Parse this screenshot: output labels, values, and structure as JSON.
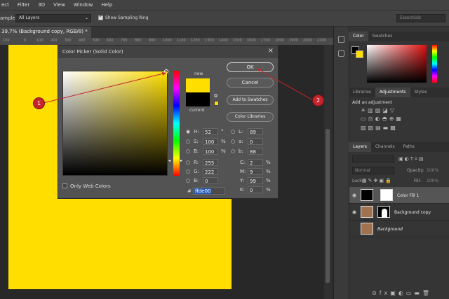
{
  "menubar": {
    "items": [
      "ect",
      "Filter",
      "3D",
      "View",
      "Window",
      "Help"
    ]
  },
  "options": {
    "sample_label": "ample:",
    "sample_value": "All Layers",
    "sampling_ring_label": "Show Sampling Ring",
    "workspace": "Essentials"
  },
  "doc": {
    "tab_title": "39,7% (Background copy, RGB/8) *",
    "ruler_ticks": [
      "100",
      "0",
      "100",
      "200",
      "300",
      "400",
      "500",
      "600",
      "700",
      "800",
      "900",
      "1000",
      "1100",
      "1200",
      "1300",
      "1400",
      "1500",
      "1600",
      "1700",
      "1800",
      "1900",
      "2000",
      "2100"
    ]
  },
  "colors": {
    "fill": "#ffde00",
    "callout": "#c6252c"
  },
  "dialog": {
    "title": "Color Picker (Solid Color)",
    "new_label": "new",
    "current_label": "current",
    "ok": "OK",
    "cancel": "Cancel",
    "add_swatches": "Add to Swatches",
    "color_libraries": "Color Libraries",
    "only_web": "Only Web Colors",
    "hsb": [
      {
        "label": "H:",
        "value": "52",
        "unit": "°"
      },
      {
        "label": "S:",
        "value": "100",
        "unit": "%"
      },
      {
        "label": "B:",
        "value": "100",
        "unit": "%"
      }
    ],
    "rgb": [
      {
        "label": "R:",
        "value": "255"
      },
      {
        "label": "G:",
        "value": "222"
      },
      {
        "label": "B:",
        "value": "0"
      }
    ],
    "lab": [
      {
        "label": "L:",
        "value": "89"
      },
      {
        "label": "a:",
        "value": "0"
      },
      {
        "label": "b:",
        "value": "88"
      }
    ],
    "cmyk": [
      {
        "label": "C:",
        "value": "2",
        "unit": "%"
      },
      {
        "label": "M:",
        "value": "9",
        "unit": "%"
      },
      {
        "label": "Y:",
        "value": "99",
        "unit": "%"
      },
      {
        "label": "K:",
        "value": "0",
        "unit": "%"
      }
    ],
    "hex_label": "#",
    "hex": "ffde00",
    "current_color": "#000000"
  },
  "callouts": [
    "1",
    "2"
  ],
  "panels": {
    "color_tabs": [
      "Color",
      "Swatches"
    ],
    "adj_tabs": [
      "Libraries",
      "Adjustments",
      "Styles"
    ],
    "add_adjustment": "Add an adjustment",
    "layers_tabs": [
      "Layers",
      "Channels",
      "Paths"
    ],
    "blend_mode": "Normal",
    "opacity_label": "Opacity:",
    "opacity": "100%",
    "lock_label": "Lock:",
    "fill_label": "Fill:",
    "fill": "100%",
    "layers": [
      {
        "name": "Color Fill 1"
      },
      {
        "name": "Background copy"
      },
      {
        "name": "Background"
      }
    ]
  }
}
